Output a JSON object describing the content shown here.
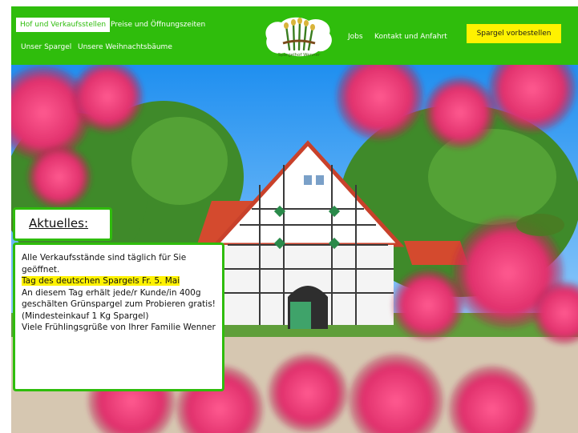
{
  "nav": {
    "items": [
      {
        "label": "Hof und Verkaufsstellen",
        "active": true
      },
      {
        "label": "Preise und Öffnungszeiten",
        "active": false
      },
      {
        "label": "Unser Spargel",
        "active": false
      },
      {
        "label": "Unsere Weihnachtsbäume",
        "active": false
      },
      {
        "label": "Jobs",
        "active": false
      },
      {
        "label": "Kontakt und Anfahrt",
        "active": false
      }
    ],
    "cta_label": "Spargel vorbestellen",
    "logo_text": "Spargelhof Wenner"
  },
  "news": {
    "heading": "Aktuelles:",
    "line1": "Alle Verkaufsstände sind täglich für Sie geöffnet.",
    "highlight": "Tag des deutschen Spargels Fr. 5. Mai",
    "line2": "An diesem Tag erhält jede/r Kunde/in 400g geschälten Grünspargel zum Probieren gratis! (Mindesteinkauf 1 Kg Spargel)",
    "line3": "Viele Frühlingsgrüße von Ihrer Familie Wenner"
  },
  "colors": {
    "brand_green": "#2fbd0c",
    "cta_yellow": "#fff200"
  }
}
